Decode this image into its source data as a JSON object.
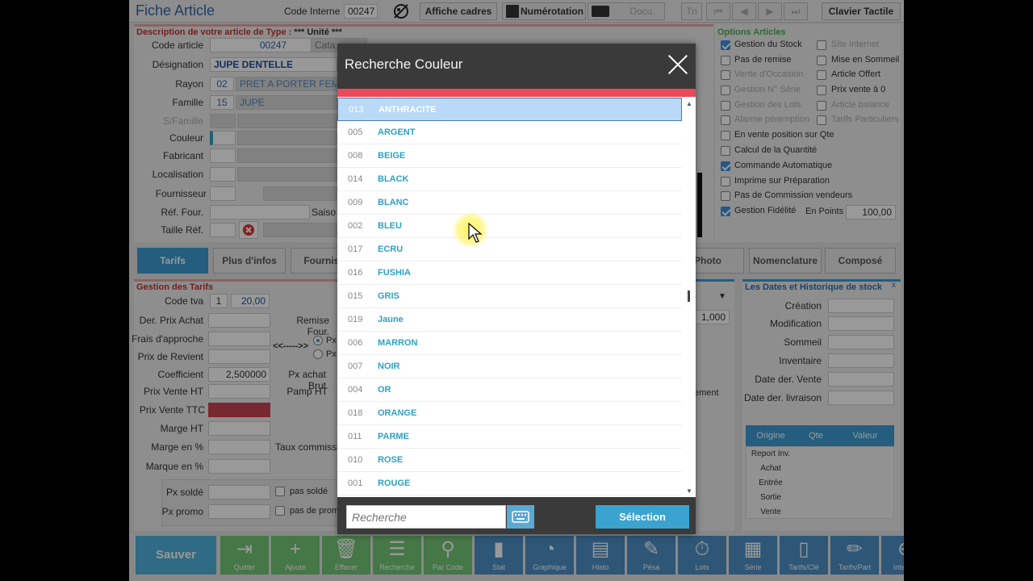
{
  "window": {
    "title": "Fiche Article",
    "code_interne_label": "Code Interne",
    "code_interne_value": "00247"
  },
  "toolbar": {
    "afficher_cadres": "Affiche cadres",
    "numerotation": "Numérotation",
    "docu": "Docu.",
    "tri": "Tri",
    "clavier_tactile": "Clavier Tactile"
  },
  "description": {
    "title": "Description de votre article de Type :",
    "type": "*** Unité ***",
    "fields": {
      "code_article": {
        "label": "Code article",
        "value": "00247"
      },
      "designation": {
        "label": "Désignation",
        "value": "JUPE DENTELLE"
      },
      "rayon": {
        "label": "Rayon",
        "code": "02",
        "value": "PRET A PORTER FEMM"
      },
      "famille": {
        "label": "Famille",
        "code": "15",
        "value": "JUPE"
      },
      "sfamille": {
        "label": "S/Famille"
      },
      "couleur": {
        "label": "Couleur"
      },
      "fabricant": {
        "label": "Fabricant"
      },
      "localisation": {
        "label": "Localisation"
      },
      "fournisseur": {
        "label": "Fournisseur"
      },
      "ref_four": {
        "label": "Réf. Four."
      },
      "saison": {
        "label": "Saiso"
      },
      "taille_ref": {
        "label": "Taille Réf."
      }
    },
    "cata_tab": "Cata"
  },
  "options": {
    "title": "Options Articles",
    "left": [
      {
        "label": "Gestion du Stock",
        "checked": true,
        "enabled": true
      },
      {
        "label": "Pas de remise",
        "checked": false,
        "enabled": true
      },
      {
        "label": "Vente d'Occasion",
        "checked": false,
        "enabled": false
      },
      {
        "label": "Gestion N° Série",
        "checked": false,
        "enabled": false
      },
      {
        "label": "Gestion des Lots",
        "checked": false,
        "enabled": false
      },
      {
        "label": "Alarme péremption",
        "checked": false,
        "enabled": false
      },
      {
        "label": "En vente position sur Qte",
        "checked": false,
        "enabled": true
      },
      {
        "label": "Calcul de la Quantité",
        "checked": false,
        "enabled": true
      },
      {
        "label": "Commande Automatique",
        "checked": true,
        "enabled": true
      },
      {
        "label": "Imprime sur Préparation",
        "checked": false,
        "enabled": true
      },
      {
        "label": "Pas de Commission vendeurs",
        "checked": false,
        "enabled": true
      },
      {
        "label": "Gestion Fidélité",
        "checked": true,
        "enabled": true
      }
    ],
    "right": [
      {
        "label": "Site Internet",
        "checked": false,
        "enabled": false
      },
      {
        "label": "Mise en Sommeil",
        "checked": false,
        "enabled": true
      },
      {
        "label": "Article Offert",
        "checked": false,
        "enabled": true
      },
      {
        "label": "Prix vente à 0",
        "checked": false,
        "enabled": true
      },
      {
        "label": "Article balance",
        "checked": false,
        "enabled": false
      },
      {
        "label": "Tarifs Particuliers",
        "checked": false,
        "enabled": false
      }
    ],
    "en_points_label": "En Points",
    "en_points_value": "100,00"
  },
  "tabs": {
    "tarifs": "Tarifs",
    "plus_infos": "Plus d'infos",
    "fournisseurs": "Fournisse",
    "photo": "Photo",
    "nomenclature": "Nomenclature",
    "compose": "Composé"
  },
  "tarifs": {
    "title": "Gestion des Tarifs",
    "code_tva_label": "Code tva",
    "code_tva": "1",
    "tva_rate": "20,00",
    "der_prix_achat": "Der. Prix Achat",
    "remise_four": "Remise Four.",
    "frais_approche": "Frais d'approche",
    "prix_revient": "Prix de Revient",
    "coefficient_label": "Coefficient",
    "coefficient": "2,500000",
    "px_achat_brut": "Px achat Brut",
    "prix_vente_ht": "Prix Vente HT",
    "pamp_ht": "Pamp HT",
    "prix_vente_ttc": "Prix Vente TTC",
    "marge_ht": "Marge HT",
    "marge_pct": "Marge en %",
    "taux_commission": "Taux commissi",
    "marque_pct": "Marque en %",
    "px_solde": "Px soldé",
    "pas_solde": "pas soldé",
    "px_promo": "Px promo",
    "pas_promo": "pas de prom",
    "arrows": "<<----->>",
    "px_radio": "Px"
  },
  "middle": {
    "qty_value": "1,000",
    "element_label": "ement"
  },
  "dates": {
    "title": "Les Dates et Historique de stock",
    "creation": "Création",
    "modification": "Modification",
    "sommeil": "Sommeil",
    "inventaire": "Inventaire",
    "date_der_vente": "Date der. Vente",
    "date_der_livraison": "Date der. livraison",
    "table_headers": [
      "Origine",
      "Qte",
      "Valeur"
    ],
    "table_rows": [
      "Report Inv.",
      "Achat",
      "Entrée",
      "Sortie",
      "Vente"
    ]
  },
  "bottom_buttons": [
    {
      "label": "Sauver",
      "icon": "save"
    },
    {
      "label": "Quitter",
      "icon": "exit-icon"
    },
    {
      "label": "Ajoute",
      "icon": "plus-icon"
    },
    {
      "label": "Effacer",
      "icon": "trash-icon"
    },
    {
      "label": "Recherche",
      "icon": "search-list-icon"
    },
    {
      "label": "Par Code",
      "icon": "magnifier-icon"
    },
    {
      "label": "Stat",
      "icon": "bar-chart-icon"
    },
    {
      "label": "Graphique",
      "icon": "pie-chart-icon"
    },
    {
      "label": "Histo",
      "icon": "book-icon"
    },
    {
      "label": "Pésa",
      "icon": "edit-icon"
    },
    {
      "label": "Lots",
      "icon": "stopwatch-icon"
    },
    {
      "label": "Série",
      "icon": "grid-icon"
    },
    {
      "label": "Tarifs/Clé",
      "icon": "phone-icon"
    },
    {
      "label": "Tarifs/Part",
      "icon": "pencil-icon"
    },
    {
      "label": "Internet",
      "icon": "globe-icon"
    }
  ],
  "modal": {
    "title": "Recherche Couleur",
    "search_placeholder": "Recherche",
    "select_label": "Sélection",
    "items": [
      {
        "code": "013",
        "name": "ANTHRACITE",
        "selected": true
      },
      {
        "code": "005",
        "name": "ARGENT"
      },
      {
        "code": "008",
        "name": "BEIGE"
      },
      {
        "code": "014",
        "name": "BLACK"
      },
      {
        "code": "009",
        "name": "BLANC"
      },
      {
        "code": "002",
        "name": "BLEU"
      },
      {
        "code": "017",
        "name": "ECRU"
      },
      {
        "code": "016",
        "name": "FUSHIA"
      },
      {
        "code": "015",
        "name": "GRIS"
      },
      {
        "code": "019",
        "name": "Jaune"
      },
      {
        "code": "006",
        "name": "MARRON"
      },
      {
        "code": "007",
        "name": "NOIR"
      },
      {
        "code": "004",
        "name": "OR"
      },
      {
        "code": "018",
        "name": "ORANGE"
      },
      {
        "code": "011",
        "name": "PARME"
      },
      {
        "code": "010",
        "name": "ROSE"
      },
      {
        "code": "001",
        "name": "ROUGE"
      }
    ]
  }
}
